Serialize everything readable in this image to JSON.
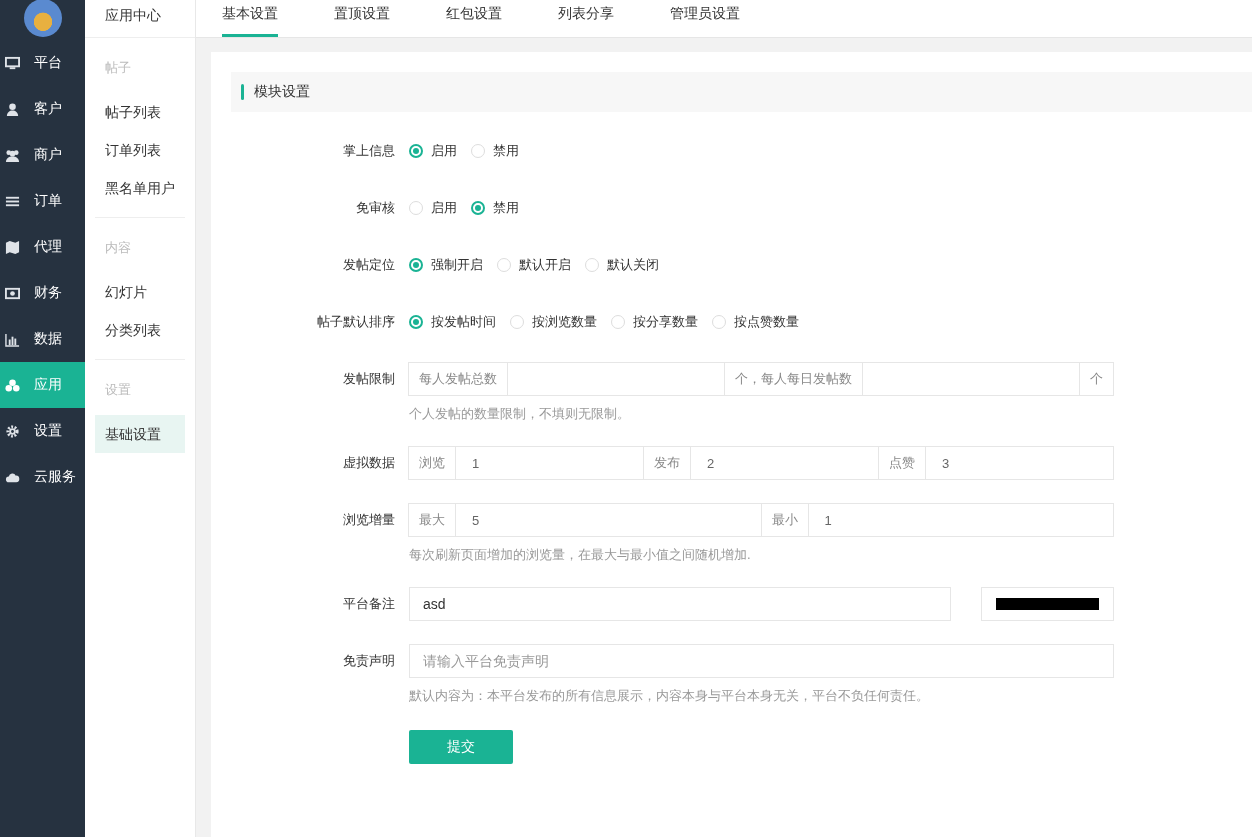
{
  "nav": [
    {
      "label": "平台",
      "selected": false
    },
    {
      "label": "客户",
      "selected": false
    },
    {
      "label": "商户",
      "selected": false
    },
    {
      "label": "订单",
      "selected": false
    },
    {
      "label": "代理",
      "selected": false
    },
    {
      "label": "财务",
      "selected": false
    },
    {
      "label": "数据",
      "selected": false
    },
    {
      "label": "应用",
      "selected": true
    },
    {
      "label": "设置",
      "selected": false
    },
    {
      "label": "云服务",
      "selected": false
    }
  ],
  "subnav": {
    "title": "应用中心",
    "groups": [
      {
        "heading": "帖子",
        "items": [
          {
            "label": "帖子列表",
            "selected": false
          },
          {
            "label": "订单列表",
            "selected": false
          },
          {
            "label": "黑名单用户",
            "selected": false
          }
        ]
      },
      {
        "heading": "内容",
        "items": [
          {
            "label": "幻灯片",
            "selected": false
          },
          {
            "label": "分类列表",
            "selected": false
          }
        ]
      },
      {
        "heading": "设置",
        "items": [
          {
            "label": "基础设置",
            "selected": true
          }
        ]
      }
    ]
  },
  "tabs": [
    {
      "label": "基本设置",
      "selected": true
    },
    {
      "label": "置顶设置",
      "selected": false
    },
    {
      "label": "红包设置",
      "selected": false
    },
    {
      "label": "列表分享",
      "selected": false
    },
    {
      "label": "管理员设置",
      "selected": false
    }
  ],
  "section_title": "模块设置",
  "form": [
    {
      "kind": "radio",
      "label": "掌上信息",
      "options": [
        {
          "label": "启用",
          "selected": true
        },
        {
          "label": "禁用",
          "selected": false
        }
      ]
    },
    {
      "kind": "radio",
      "label": "免审核",
      "options": [
        {
          "label": "启用",
          "selected": false
        },
        {
          "label": "禁用",
          "selected": true
        }
      ]
    },
    {
      "kind": "radio",
      "label": "发帖定位",
      "options": [
        {
          "label": "强制开启",
          "selected": true
        },
        {
          "label": "默认开启",
          "selected": false
        },
        {
          "label": "默认关闭",
          "selected": false
        }
      ]
    },
    {
      "kind": "radio",
      "label": "帖子默认排序",
      "options": [
        {
          "label": "按发帖时间",
          "selected": true
        },
        {
          "label": "按浏览数量",
          "selected": false
        },
        {
          "label": "按分享数量",
          "selected": false
        },
        {
          "label": "按点赞数量",
          "selected": false
        }
      ]
    },
    {
      "kind": "group",
      "label": "发帖限制",
      "parts": [
        {
          "kind": "addon",
          "text": "每人发帖总数"
        },
        {
          "kind": "input"
        },
        {
          "kind": "addon",
          "text": "个，每人每日发帖数"
        },
        {
          "kind": "input"
        },
        {
          "kind": "addon",
          "text": "个"
        }
      ],
      "help": "个人发帖的数量限制，不填则无限制。"
    },
    {
      "kind": "group",
      "label": "虚拟数据",
      "parts": [
        {
          "kind": "addon",
          "text": "浏览"
        },
        {
          "kind": "input",
          "value": "1"
        },
        {
          "kind": "addon",
          "text": "发布"
        },
        {
          "kind": "input",
          "value": "2"
        },
        {
          "kind": "addon",
          "text": "点赞"
        },
        {
          "kind": "input",
          "value": "3"
        }
      ]
    },
    {
      "kind": "group",
      "label": "浏览增量",
      "parts": [
        {
          "kind": "addon",
          "text": "最大"
        },
        {
          "kind": "input",
          "value": "5"
        },
        {
          "kind": "addon",
          "text": "最小"
        },
        {
          "kind": "input",
          "value": "1"
        }
      ],
      "help": "每次刷新页面增加的浏览量，在最大与最小值之间随机增加."
    },
    {
      "kind": "color",
      "label": "平台备注",
      "value": "asd",
      "color": "#000000"
    },
    {
      "kind": "text",
      "label": "免责声明",
      "placeholder": "请输入平台免责声明",
      "help": "默认内容为：本平台发布的所有信息展示，内容本身与平台本身无关，平台不负任何责任。"
    }
  ],
  "submit": "提交"
}
